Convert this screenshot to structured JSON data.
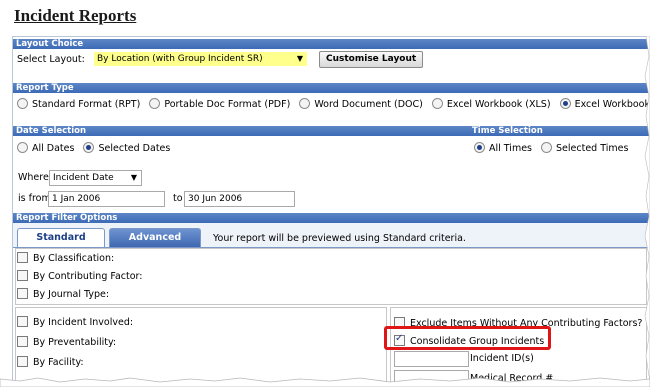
{
  "page": {
    "title": "Incident Reports"
  },
  "layout": {
    "header": "Layout Choice",
    "select_label": "Select Layout:",
    "selected_value": "By Location (with Group Incident SR)",
    "customise_label": "Customise Layout"
  },
  "report_type": {
    "header": "Report Type",
    "options": [
      {
        "label": "Standard Format (RPT)",
        "selected": false
      },
      {
        "label": "Portable Doc Format (PDF)",
        "selected": false
      },
      {
        "label": "Word Document (DOC)",
        "selected": false
      },
      {
        "label": "Excel Workbook (XLS)",
        "selected": false
      },
      {
        "label": "Excel Workbook",
        "selected": true
      }
    ]
  },
  "date_selection": {
    "header": "Date Selection",
    "all_dates": "All Dates",
    "selected_dates": "Selected Dates",
    "where_label": "Where",
    "where_value": "Incident Date",
    "is_from_label": "is from",
    "from_value": "1 Jan 2006",
    "to_label": "to",
    "to_value": "30 Jun 2006"
  },
  "time_selection": {
    "header": "Time Selection",
    "all_times": "All Times",
    "selected_times": "Selected Times"
  },
  "filter": {
    "header": "Report Filter Options",
    "tabs": [
      "Standard",
      "Advanced"
    ],
    "note": "Your report will be previewed using Standard criteria.",
    "group1": [
      "By Classification:",
      "By Contributing Factor:",
      "By Journal Type:"
    ],
    "group2": [
      "By Incident Involved:",
      "By Preventability:",
      "By Facility:"
    ],
    "exclude_label": "Exclude Items Without Any Contributing Factors?",
    "consolidate_label": "Consolidate Group Incidents",
    "incident_id_label": "Incident ID(s)",
    "medical_record_label": "Medical Record #"
  },
  "colors": {
    "band": "#3c6ab5",
    "select_highlight": "#ffff8c",
    "callout": "#e01515",
    "tab_inactive": "#4d78bf"
  }
}
